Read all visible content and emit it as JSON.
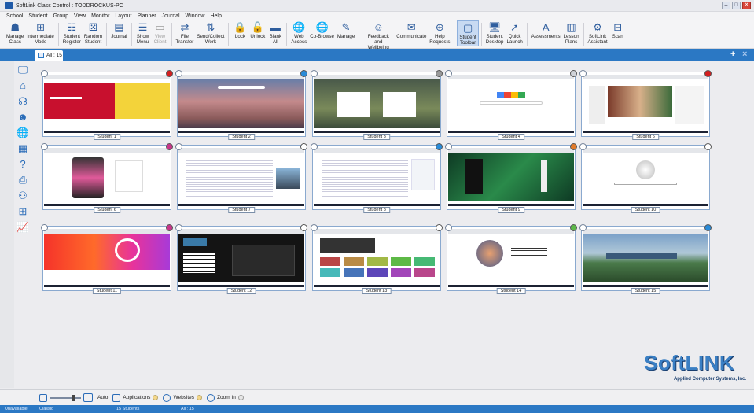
{
  "window": {
    "title": "SoftLink Class Control : TODDROCKUS-PC",
    "min": "–",
    "max": "□",
    "close": "✕"
  },
  "menu": [
    "School",
    "Student",
    "Group",
    "View",
    "Monitor",
    "Layout",
    "Planner",
    "Journal",
    "Window",
    "Help"
  ],
  "toolbar": [
    {
      "label": "Manage\nClass",
      "icon": "manage-class-icon",
      "glyph": "☗"
    },
    {
      "label": "Intermediate\nMode",
      "icon": "intermediate-mode-icon",
      "glyph": "⊞"
    },
    {
      "label": "Student\nRegister",
      "icon": "student-register-icon",
      "glyph": "☷"
    },
    {
      "label": "Random\nStudent",
      "icon": "random-student-icon",
      "glyph": "⚄"
    },
    {
      "label": "Journal",
      "icon": "journal-icon",
      "glyph": "▤"
    },
    {
      "label": "Show\nMenu",
      "icon": "show-menu-icon",
      "glyph": "☰"
    },
    {
      "label": "View\nClient",
      "icon": "view-client-icon",
      "glyph": "▭",
      "dim": true
    },
    {
      "label": "File\nTransfer",
      "icon": "file-transfer-icon",
      "glyph": "⇄"
    },
    {
      "label": "Send/Collect\nWork",
      "icon": "send-collect-icon",
      "glyph": "⇅"
    },
    {
      "label": "Lock",
      "icon": "lock-icon",
      "glyph": "🔒"
    },
    {
      "label": "Unlock",
      "icon": "unlock-icon",
      "glyph": "🔓"
    },
    {
      "label": "Blank\nAll",
      "icon": "blank-all-icon",
      "glyph": "▬"
    },
    {
      "label": "Web\nAccess",
      "icon": "web-access-icon",
      "glyph": "🌐"
    },
    {
      "label": "Co-Browse",
      "icon": "co-browse-icon",
      "glyph": "🌐"
    },
    {
      "label": "Manage",
      "icon": "manage-icon",
      "glyph": "✎"
    },
    {
      "label": "Feedback and\nWellbeing",
      "icon": "feedback-icon",
      "glyph": "☺"
    },
    {
      "label": "Communicate",
      "icon": "communicate-icon",
      "glyph": "✉"
    },
    {
      "label": "Help\nRequests",
      "icon": "help-requests-icon",
      "glyph": "⊕"
    },
    {
      "label": "Student\nToolbar",
      "icon": "student-toolbar-icon",
      "glyph": "▢",
      "active": true
    },
    {
      "label": "Student\nDesktop",
      "icon": "student-desktop-icon",
      "glyph": "🖥"
    },
    {
      "label": "Quick\nLaunch",
      "icon": "quick-launch-icon",
      "glyph": "➚"
    },
    {
      "label": "Assessments",
      "icon": "assessments-icon",
      "glyph": "A"
    },
    {
      "label": "Lesson\nPlans",
      "icon": "lesson-plans-icon",
      "glyph": "▥"
    },
    {
      "label": "SoftLink\nAssistant",
      "icon": "softlink-assistant-icon",
      "glyph": "⚙"
    },
    {
      "label": "Scan",
      "icon": "scan-icon",
      "glyph": "⊟"
    }
  ],
  "tab": {
    "label": "All : 15"
  },
  "tabctl": {
    "add": "+",
    "close": "×"
  },
  "sidebar_icons": [
    "desktop-icon",
    "home-icon",
    "headphones-icon",
    "user-speak-icon",
    "globe-icon",
    "grid-icon",
    "help-icon",
    "printer-icon",
    "usb-icon",
    "apps-icon",
    "chart-icon"
  ],
  "students": [
    {
      "name": "Student 1",
      "status": "#d41f1f",
      "site": "red",
      "accent": "#e8c21c"
    },
    {
      "name": "Student 2",
      "status": "#2a8bd8",
      "site": "canyon",
      "accent": "#b8777a"
    },
    {
      "name": "Student 3",
      "status": "#9a9a9a",
      "site": "signin",
      "accent": "#6a8f4a"
    },
    {
      "name": "Student 4",
      "status": "#cfd2d8",
      "site": "google",
      "accent": "#ffffff"
    },
    {
      "name": "Student 5",
      "status": "#d41f1f",
      "site": "espn",
      "accent": "#f0a41d"
    },
    {
      "name": "Student 6",
      "status": "#c8368a",
      "site": "instagram",
      "accent": "#ffffff"
    },
    {
      "name": "Student 7",
      "status": "#ffffff",
      "site": "wiki",
      "accent": "#ffffff"
    },
    {
      "name": "Student 8",
      "status": "#2a8bd8",
      "site": "office",
      "accent": "#ffffff"
    },
    {
      "name": "Student 9",
      "status": "#e07a2a",
      "site": "xbox",
      "accent": "#1a5a3a"
    },
    {
      "name": "Student 10",
      "status": "#ffffff",
      "site": "wikipedia",
      "accent": "#ffffff"
    },
    {
      "name": "Student 11",
      "status": "#c8368a",
      "site": "adobe",
      "accent": "#e82a4a"
    },
    {
      "name": "Student 12",
      "status": "#ffffff",
      "site": "rvpro",
      "accent": "#1a1a1a"
    },
    {
      "name": "Student 13",
      "status": "#ffffff",
      "site": "youtube",
      "accent": "#ffffff"
    },
    {
      "name": "Student 14",
      "status": "#5cb84a",
      "site": "edu",
      "accent": "#ffffff"
    },
    {
      "name": "Student 15",
      "status": "#2a8bd8",
      "site": "landscape",
      "accent": "#4a7a8a"
    }
  ],
  "logo": {
    "brand": "SoftLINK",
    "sub": "Applied Computer Systems, Inc."
  },
  "bottom": {
    "auto": "Auto",
    "applications": "Applications",
    "websites": "Websites",
    "zoomin": "Zoom In"
  },
  "status": {
    "left": "Unavailable",
    "view": "Classic",
    "students": "15 Students",
    "all": "All : 15"
  }
}
